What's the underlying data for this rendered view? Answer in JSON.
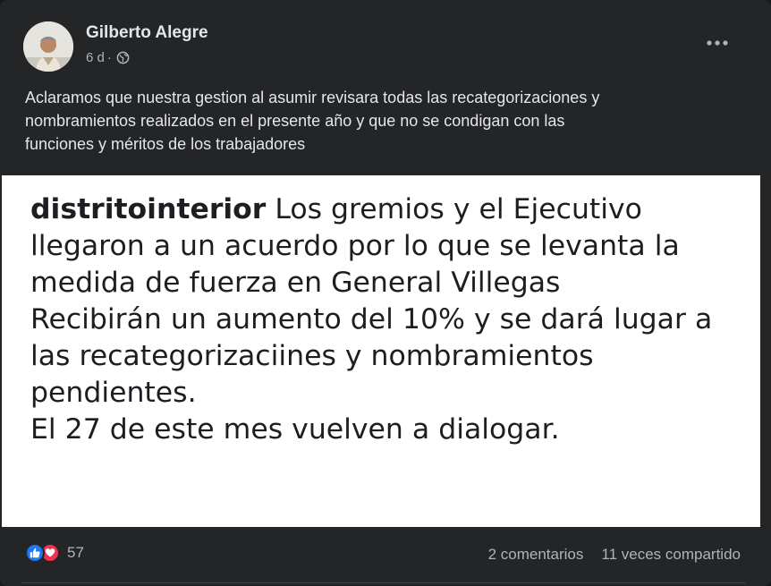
{
  "post": {
    "author": "Gilberto Alegre",
    "time": "6 d",
    "separator": "·",
    "audience_icon": "globe-icon",
    "more_icon": "more-options-icon",
    "caption": [
      "Aclaramos que nuestra gestion al asumir revisara todas las recategorizaciones y",
      "nombramientos realizados en el presente año y que no se  condigan con las",
      "funciones y méritos de los trabajadores"
    ]
  },
  "image": {
    "username": "distritointerior",
    "first_line_rest": " Los gremios y el Ejecutivo",
    "lines": [
      "llegaron a un acuerdo por lo que se levanta la",
      "medida de fuerza en General Villegas",
      "Recibirán un aumento del 10% y se dará lugar a",
      "las recategorizaciines y nombramientos",
      "pendientes.",
      "El 27 de este mes vuelven a dialogar."
    ]
  },
  "footer": {
    "reaction_icons": [
      "like-icon",
      "love-icon"
    ],
    "reaction_count": "57",
    "comments": "2 comentarios",
    "shares": "11 veces compartido"
  },
  "colors": {
    "background": "#242526",
    "like": "#2078f4",
    "love": "#f0334e",
    "secondary_text": "#b0b3b8"
  }
}
